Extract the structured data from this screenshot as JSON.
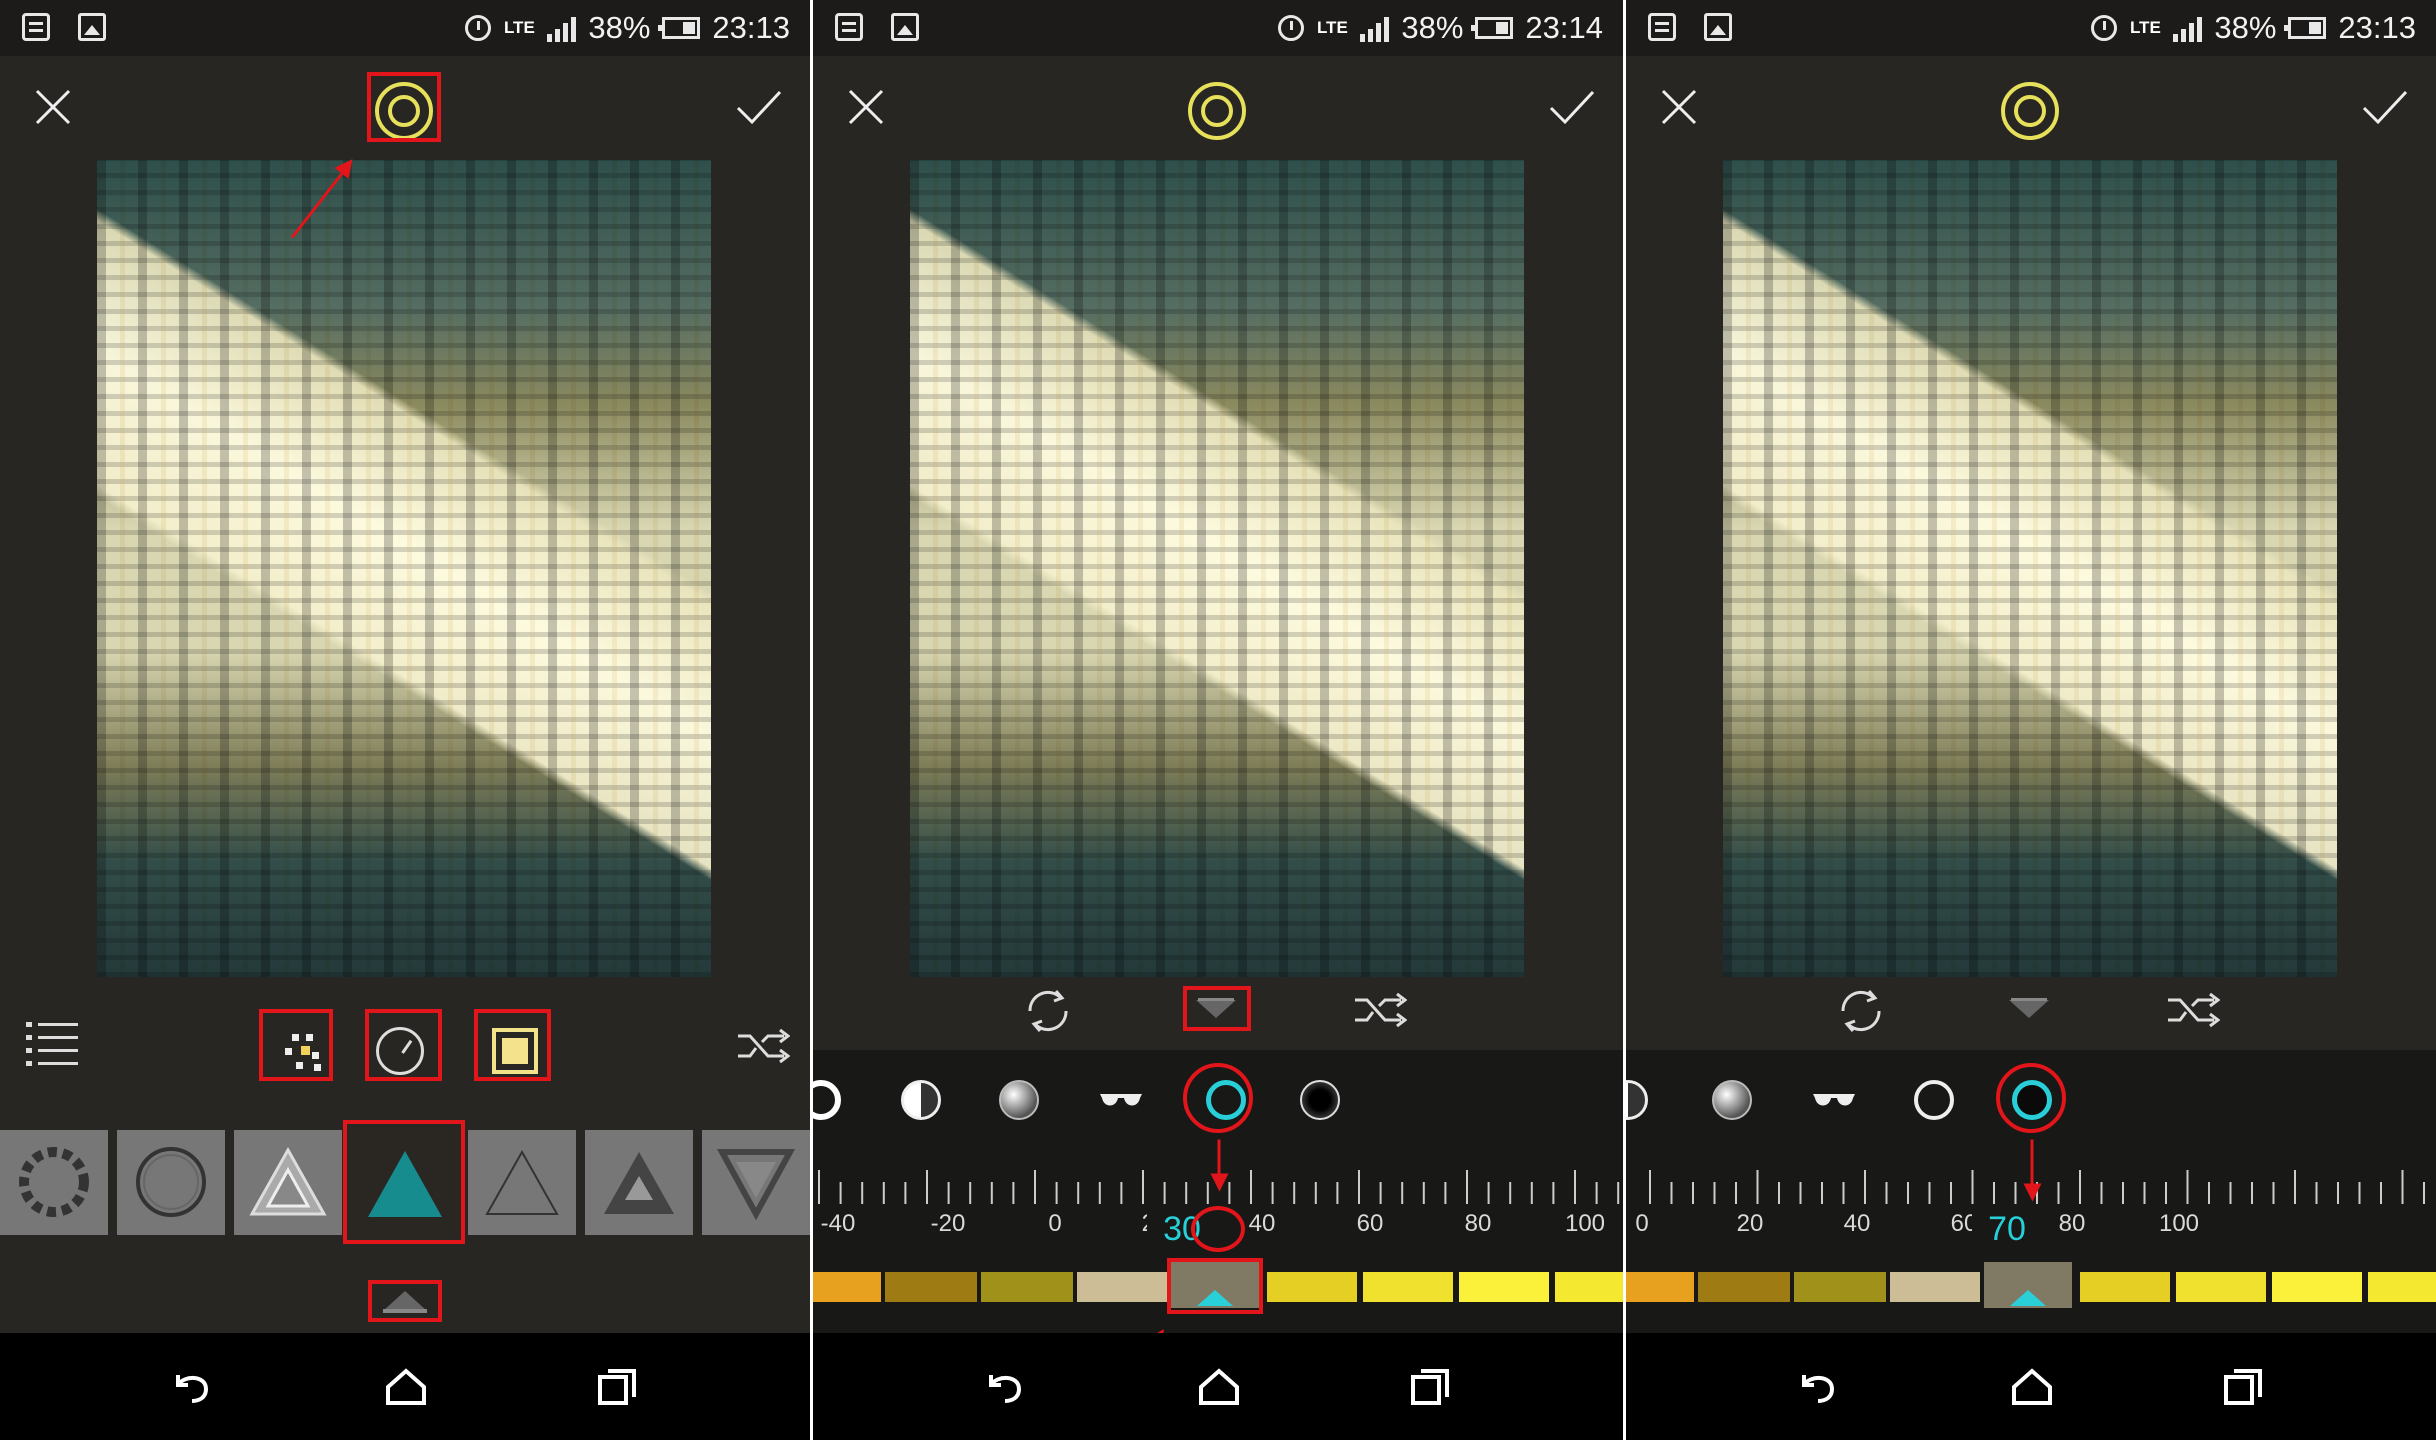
{
  "status_bar": [
    {
      "battery": "38%",
      "time": "23:13",
      "network": "LTE"
    },
    {
      "battery": "38%",
      "time": "23:14",
      "network": "LTE"
    },
    {
      "battery": "38%",
      "time": "23:13",
      "network": "LTE"
    }
  ],
  "accent_colors": {
    "mask_icon": "#e6e05a",
    "selection": "#29cfd8",
    "annotation": "#e1151a"
  },
  "icons": {
    "top": [
      "close-icon",
      "mask-icon",
      "check-icon"
    ],
    "panel1_modes": [
      "pixel-icon",
      "dial-icon",
      "square-icon"
    ],
    "panel23_controls": [
      "rotate-icon",
      "collapse-toggle",
      "shuffle-icon"
    ],
    "nav": [
      "back-icon",
      "home-icon",
      "recents-icon"
    ]
  },
  "panel1": {
    "shapes": [
      "ring-shape",
      "circle-shape",
      "triangle-outline-shape",
      "triangle-filled-shape",
      "triangle-thin-shape",
      "triangle-split-shape",
      "triangle-inverted-shape"
    ],
    "selected_shape": "triangle-filled-shape"
  },
  "panel2": {
    "ruler_labels": [
      "-40",
      "-20",
      "0",
      "20",
      "40",
      "60",
      "80",
      "100"
    ],
    "selected_value": "30",
    "selected_value_level": 30
  },
  "panel3": {
    "ruler_labels": [
      "0",
      "20",
      "40",
      "60",
      "80",
      "100"
    ],
    "selected_value": "70",
    "selected_value_level": 70
  },
  "swatch_colors_panel2": [
    "#e7a11f",
    "#9f7b14",
    "#9f911a",
    "#cdbd96",
    "#807a65",
    "#e6cf24",
    "#f1e12f",
    "#fbf03a",
    "#f4e830"
  ],
  "swatch_colors_panel3": [
    "#e7a11f",
    "#9f7b14",
    "#9f911a",
    "#cdbd96",
    "#807a65",
    "#e6cf24",
    "#f1e12f",
    "#fbf03a",
    "#f4e830"
  ]
}
